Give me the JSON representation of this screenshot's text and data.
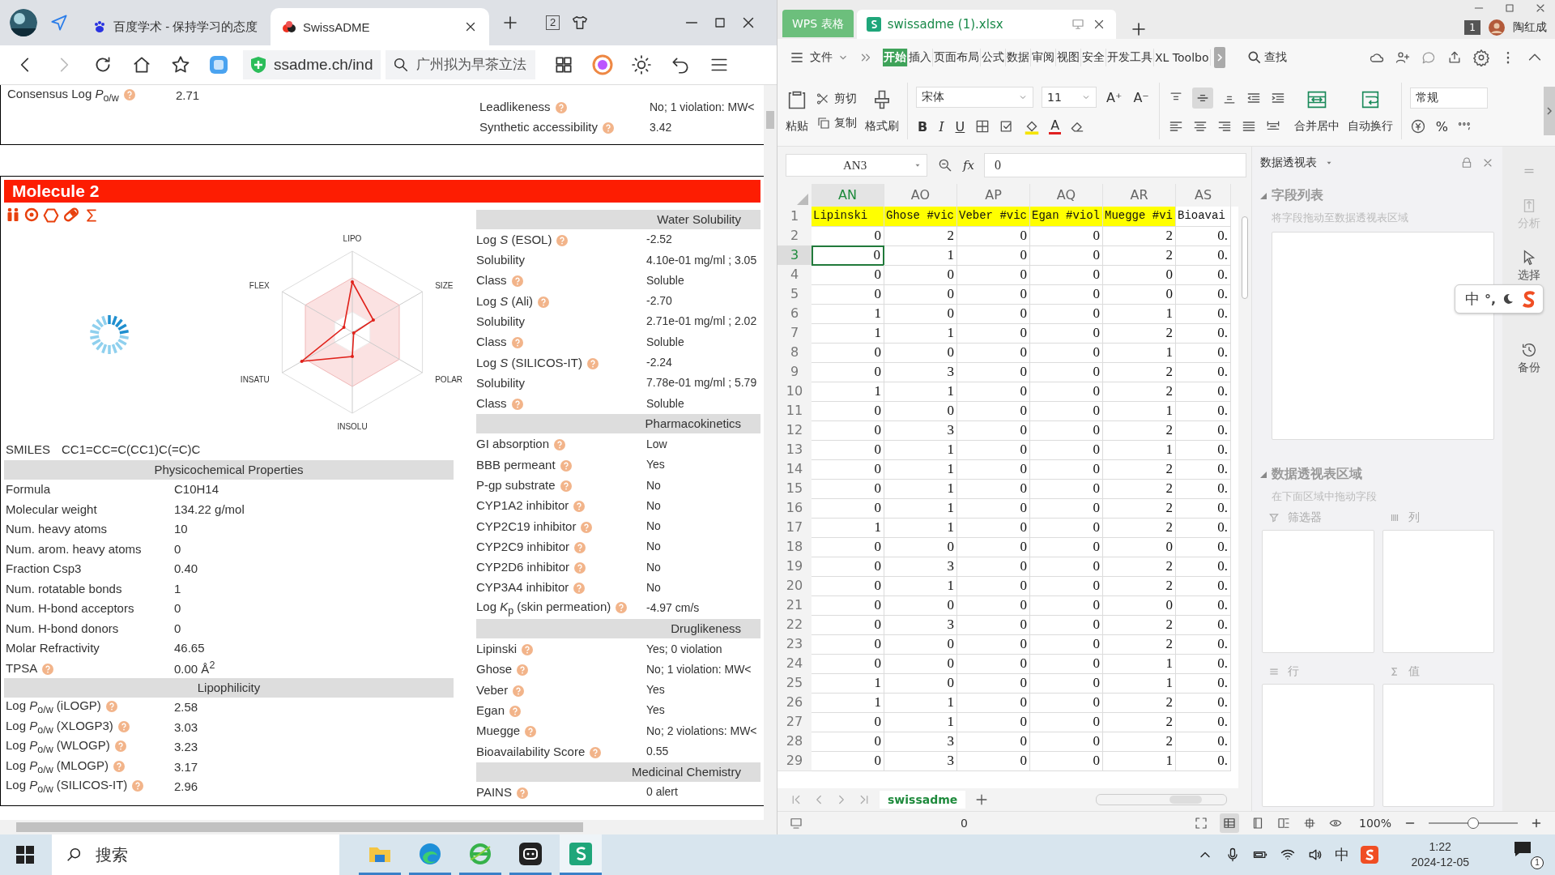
{
  "browser": {
    "tabs": [
      {
        "title": "百度学术 - 保持学习的态度",
        "selected": false
      },
      {
        "title": "SwissADME",
        "selected": true
      }
    ],
    "tab_count": "2",
    "address": "ssadme.ch/ind",
    "search_placeholder": "广州拟为早茶立法",
    "page": {
      "previous": {
        "left": [
          {
            "label": "Consensus Log *P*$_{o/w}$",
            "value": "2.71",
            "help": true
          }
        ],
        "right": [
          {
            "label": "Leadlikeness",
            "value": "No; 1 violation: MW<",
            "help": true
          },
          {
            "label": "Synthetic accessibility",
            "value": "3.42",
            "help": true
          }
        ]
      },
      "molecule": {
        "title": "Molecule 2",
        "radar_axes": [
          "LIPO",
          "SIZE",
          "POLAR",
          "INSOLU",
          "INSATU",
          "FLEX"
        ],
        "smiles": {
          "label": "SMILES",
          "value": "CC1=CC=C(CC1)C(=C)C"
        },
        "left_sections": [
          {
            "heading": "Physicochemical Properties",
            "rows": [
              {
                "label": "Formula",
                "value": "C10H14",
                "help": false
              },
              {
                "label": "Molecular weight",
                "value": "134.22 g/mol",
                "help": false
              },
              {
                "label": "Num. heavy atoms",
                "value": "10",
                "help": false
              },
              {
                "label": "Num. arom. heavy atoms",
                "value": "0",
                "help": false
              },
              {
                "label": "Fraction Csp3",
                "value": "0.40",
                "help": false
              },
              {
                "label": "Num. rotatable bonds",
                "value": "1",
                "help": false
              },
              {
                "label": "Num. H-bond acceptors",
                "value": "0",
                "help": false
              },
              {
                "label": "Num. H-bond donors",
                "value": "0",
                "help": false
              },
              {
                "label": "Molar Refractivity",
                "value": "46.65",
                "help": false
              },
              {
                "label": "TPSA",
                "value": "0.00 Å$^{2}$",
                "help": true
              }
            ]
          },
          {
            "heading": "Lipophilicity",
            "rows": [
              {
                "label": "Log *P*$_{o/w}$ (iLOGP)",
                "value": "2.58",
                "help": true
              },
              {
                "label": "Log *P*$_{o/w}$ (XLOGP3)",
                "value": "3.03",
                "help": true
              },
              {
                "label": "Log *P*$_{o/w}$ (WLOGP)",
                "value": "3.23",
                "help": true
              },
              {
                "label": "Log *P*$_{o/w}$ (MLOGP)",
                "value": "3.17",
                "help": true
              },
              {
                "label": "Log *P*$_{o/w}$ (SILICOS-IT)",
                "value": "2.96",
                "help": true
              }
            ]
          }
        ],
        "right_sections": [
          {
            "heading": "Water Solubility",
            "rows": [
              {
                "label": "Log *S* (ESOL)",
                "value": "-2.52",
                "help": true
              },
              {
                "label": "Solubility",
                "value": "4.10e-01 mg/ml ; 3.05",
                "help": false
              },
              {
                "label": "Class",
                "value": "Soluble",
                "help": true
              },
              {
                "label": "Log *S* (Ali)",
                "value": "-2.70",
                "help": true
              },
              {
                "label": "Solubility",
                "value": "2.71e-01 mg/ml ; 2.02",
                "help": false
              },
              {
                "label": "Class",
                "value": "Soluble",
                "help": true
              },
              {
                "label": "Log *S* (SILICOS-IT)",
                "value": "-2.24",
                "help": true
              },
              {
                "label": "Solubility",
                "value": "7.78e-01 mg/ml ; 5.79",
                "help": false
              },
              {
                "label": "Class",
                "value": "Soluble",
                "help": true
              }
            ]
          },
          {
            "heading": "Pharmacokinetics",
            "rows": [
              {
                "label": "GI absorption",
                "value": "Low",
                "help": true
              },
              {
                "label": "BBB permeant",
                "value": "Yes",
                "help": true
              },
              {
                "label": "P-gp substrate",
                "value": "No",
                "help": true
              },
              {
                "label": "CYP1A2 inhibitor",
                "value": "No",
                "help": true
              },
              {
                "label": "CYP2C19 inhibitor",
                "value": "No",
                "help": true
              },
              {
                "label": "CYP2C9 inhibitor",
                "value": "No",
                "help": true
              },
              {
                "label": "CYP2D6 inhibitor",
                "value": "No",
                "help": true
              },
              {
                "label": "CYP3A4 inhibitor",
                "value": "No",
                "help": true
              },
              {
                "label": "Log *K*$_{p}$ (skin permeation)",
                "value": "-4.97 cm/s",
                "help": true
              }
            ]
          },
          {
            "heading": "Druglikeness",
            "rows": [
              {
                "label": "Lipinski",
                "value": "Yes; 0 violation",
                "help": true
              },
              {
                "label": "Ghose",
                "value": "No; 1 violation: MW<",
                "help": true
              },
              {
                "label": "Veber",
                "value": "Yes",
                "help": true
              },
              {
                "label": "Egan",
                "value": "Yes",
                "help": true
              },
              {
                "label": "Muegge",
                "value": "No; 2 violations: MW<",
                "help": true
              },
              {
                "label": "Bioavailability Score",
                "value": "0.55",
                "help": true
              }
            ]
          },
          {
            "heading": "Medicinal Chemistry",
            "rows": [
              {
                "label": "PAINS",
                "value": "0 alert",
                "help": true
              }
            ]
          }
        ]
      }
    }
  },
  "wps": {
    "app_tab": "WPS 表格",
    "file_tab": "swissadme (1).xlsx",
    "badge": "1",
    "user": "陶红成",
    "file_menu": "文件",
    "menu_tabs": [
      {
        "label": "开始",
        "selected": true
      },
      {
        "label": "插入",
        "selected": false
      },
      {
        "label": "页面布局",
        "selected": false
      },
      {
        "label": "公式",
        "selected": false
      },
      {
        "label": "数据",
        "selected": false
      },
      {
        "label": "审阅",
        "selected": false
      },
      {
        "label": "视图",
        "selected": false
      },
      {
        "label": "安全",
        "selected": false
      },
      {
        "label": "开发工具",
        "selected": false
      },
      {
        "label": "XL Toolbo",
        "selected": false
      }
    ],
    "find": "查找",
    "ribbon": {
      "paste": "粘贴",
      "cut": "剪切",
      "copy": "复制",
      "format_painter": "格式刷",
      "font": "宋体",
      "font_size": "11",
      "size_buttons": [
        "A⁺",
        "A⁻"
      ],
      "style_buttons": [
        "B",
        "I",
        "U"
      ],
      "font_color": "A",
      "merge": "合并居中",
      "wrap": "自动换行",
      "number_format": "常规",
      "percent": "%"
    },
    "name_box": "AN3",
    "fx": "fx",
    "formula": "0",
    "columns": [
      {
        "label": "AN",
        "selected": true
      },
      {
        "label": "AO",
        "selected": false
      },
      {
        "label": "AP",
        "selected": false
      },
      {
        "label": "AQ",
        "selected": false
      },
      {
        "label": "AR",
        "selected": false
      },
      {
        "label": "AS",
        "selected": false
      }
    ],
    "header_row": {
      "num": "1",
      "cells": [
        "Lipinski",
        "Ghose #vic",
        "Veber #vic",
        "Egan #viol",
        "Muegge #vi",
        "Bioavai"
      ]
    },
    "rows": [
      {
        "num": "2",
        "selected": false,
        "cells": [
          "0",
          "2",
          "0",
          "0",
          "2",
          "0."
        ]
      },
      {
        "num": "3",
        "selected": true,
        "cells": [
          "0",
          "1",
          "0",
          "0",
          "2",
          "0."
        ]
      },
      {
        "num": "4",
        "selected": false,
        "cells": [
          "0",
          "0",
          "0",
          "0",
          "0",
          "0."
        ]
      },
      {
        "num": "5",
        "selected": false,
        "cells": [
          "0",
          "0",
          "0",
          "0",
          "0",
          "0."
        ]
      },
      {
        "num": "6",
        "selected": false,
        "cells": [
          "1",
          "0",
          "0",
          "0",
          "1",
          "0."
        ]
      },
      {
        "num": "7",
        "selected": false,
        "cells": [
          "1",
          "1",
          "0",
          "0",
          "2",
          "0."
        ]
      },
      {
        "num": "8",
        "selected": false,
        "cells": [
          "0",
          "0",
          "0",
          "0",
          "1",
          "0."
        ]
      },
      {
        "num": "9",
        "selected": false,
        "cells": [
          "0",
          "3",
          "0",
          "0",
          "2",
          "0."
        ]
      },
      {
        "num": "10",
        "selected": false,
        "cells": [
          "1",
          "1",
          "0",
          "0",
          "2",
          "0."
        ]
      },
      {
        "num": "11",
        "selected": false,
        "cells": [
          "0",
          "0",
          "0",
          "0",
          "1",
          "0."
        ]
      },
      {
        "num": "12",
        "selected": false,
        "cells": [
          "0",
          "3",
          "0",
          "0",
          "2",
          "0."
        ]
      },
      {
        "num": "13",
        "selected": false,
        "cells": [
          "0",
          "1",
          "0",
          "0",
          "1",
          "0."
        ]
      },
      {
        "num": "14",
        "selected": false,
        "cells": [
          "0",
          "1",
          "0",
          "0",
          "2",
          "0."
        ]
      },
      {
        "num": "15",
        "selected": false,
        "cells": [
          "0",
          "1",
          "0",
          "0",
          "2",
          "0."
        ]
      },
      {
        "num": "16",
        "selected": false,
        "cells": [
          "0",
          "1",
          "0",
          "0",
          "2",
          "0."
        ]
      },
      {
        "num": "17",
        "selected": false,
        "cells": [
          "1",
          "1",
          "0",
          "0",
          "2",
          "0."
        ]
      },
      {
        "num": "18",
        "selected": false,
        "cells": [
          "0",
          "0",
          "0",
          "0",
          "0",
          "0."
        ]
      },
      {
        "num": "19",
        "selected": false,
        "cells": [
          "0",
          "3",
          "0",
          "0",
          "2",
          "0."
        ]
      },
      {
        "num": "20",
        "selected": false,
        "cells": [
          "0",
          "1",
          "0",
          "0",
          "2",
          "0."
        ]
      },
      {
        "num": "21",
        "selected": false,
        "cells": [
          "0",
          "0",
          "0",
          "0",
          "0",
          "0."
        ]
      },
      {
        "num": "22",
        "selected": false,
        "cells": [
          "0",
          "3",
          "0",
          "0",
          "2",
          "0."
        ]
      },
      {
        "num": "23",
        "selected": false,
        "cells": [
          "0",
          "0",
          "0",
          "0",
          "2",
          "0."
        ]
      },
      {
        "num": "24",
        "selected": false,
        "cells": [
          "0",
          "0",
          "0",
          "0",
          "1",
          "0."
        ]
      },
      {
        "num": "25",
        "selected": false,
        "cells": [
          "1",
          "0",
          "0",
          "0",
          "1",
          "0."
        ]
      },
      {
        "num": "26",
        "selected": false,
        "cells": [
          "1",
          "1",
          "0",
          "0",
          "2",
          "0."
        ]
      },
      {
        "num": "27",
        "selected": false,
        "cells": [
          "0",
          "1",
          "0",
          "0",
          "2",
          "0."
        ]
      },
      {
        "num": "28",
        "selected": false,
        "cells": [
          "0",
          "3",
          "0",
          "0",
          "2",
          "0."
        ]
      },
      {
        "num": "29",
        "selected": false,
        "cells": [
          "0",
          "3",
          "0",
          "0",
          "1",
          "0."
        ]
      }
    ],
    "sheet_tab": "swissadme",
    "status_value": "0",
    "zoom": "100%",
    "zoom_slider": {
      "level": 0.5
    },
    "pivot": {
      "title": "数据透视表",
      "field_section": "字段列表",
      "field_hint": "将字段拖动至数据透视表区域",
      "area_section": "数据透视表区域",
      "area_hint": "在下面区域中拖动字段",
      "areas": [
        {
          "label": "筛选器",
          "kind": "filter"
        },
        {
          "label": "列",
          "kind": "column"
        },
        {
          "label": "行",
          "kind": "row"
        },
        {
          "label": "值",
          "kind": "value"
        }
      ]
    },
    "side_tools": [
      {
        "label": "分析",
        "kind": "analyze",
        "disabled": true
      },
      {
        "label": "选择",
        "kind": "select",
        "disabled": false
      },
      {
        "label": "备份",
        "kind": "backup",
        "disabled": false
      }
    ]
  },
  "ime": {
    "mode": "中",
    "punct": "°,"
  },
  "taskbar": {
    "search": "搜索",
    "ime": "中",
    "time": "1:22",
    "date": "2024-12-05",
    "notifications": "1"
  }
}
